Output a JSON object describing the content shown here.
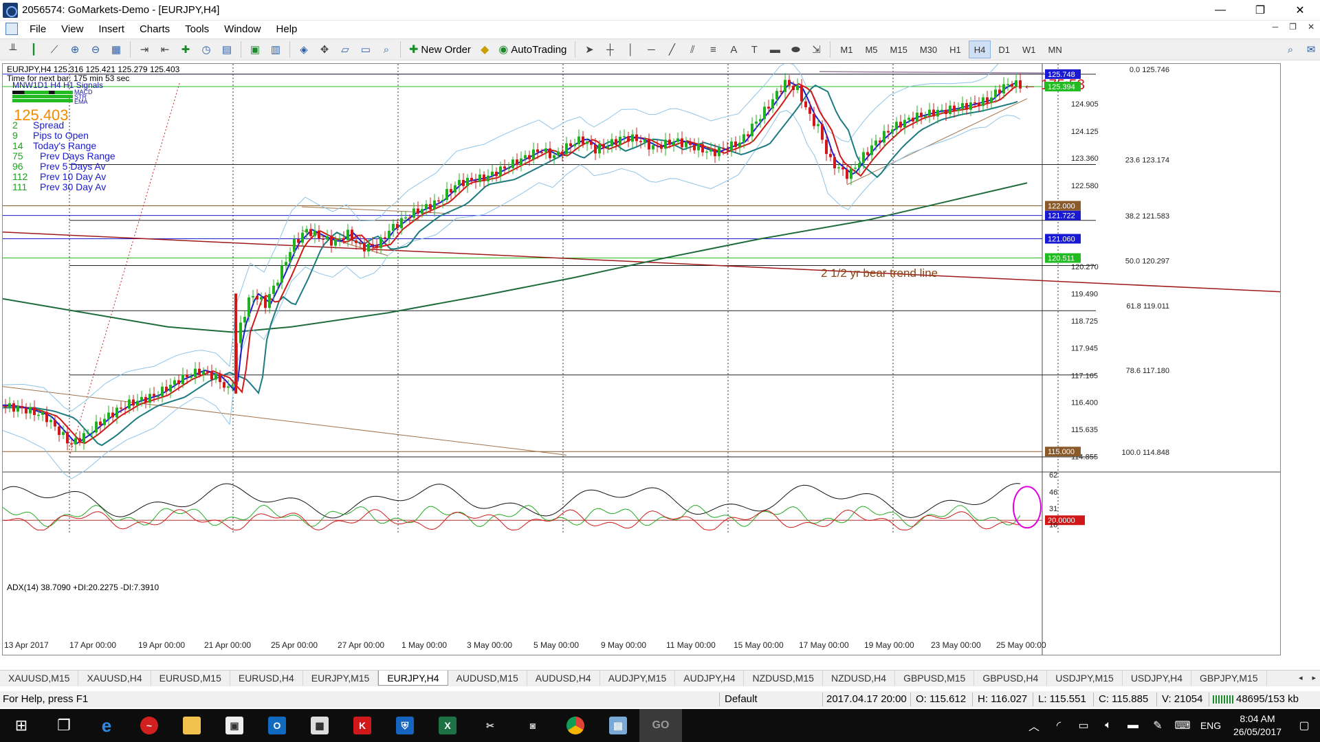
{
  "window": {
    "title": "2056574: GoMarkets-Demo - [EURJPY,H4]",
    "controls": [
      "—",
      "❐",
      "✕"
    ]
  },
  "menu": [
    "File",
    "View",
    "Insert",
    "Charts",
    "Tools",
    "Window",
    "Help"
  ],
  "toolbar": {
    "new_order": "New Order",
    "autotrading": "AutoTrading",
    "timeframes": [
      "M1",
      "M5",
      "M15",
      "M30",
      "H1",
      "H4",
      "D1",
      "W1",
      "MN"
    ],
    "active_timeframe": "H4"
  },
  "chart": {
    "symbol_line": "EURJPY,H4  125.316 125.421 125.279 125.403",
    "time_next_bar": "Time for next bar: 175 min 53 sec",
    "indicator_row": "MNW1D1 H4 H1 Signals",
    "indicator_sub": [
      "MACD",
      "STR",
      "EMA"
    ],
    "big_price": "125.403",
    "stats": [
      {
        "value": "2",
        "label": "Spread"
      },
      {
        "value": "9",
        "label": "Pips to Open"
      },
      {
        "value": "14",
        "label": "Today's Range"
      },
      {
        "value": "75",
        "label": "Prev Days Range"
      },
      {
        "value": "96",
        "label": "Prev 5 Days Av"
      },
      {
        "value": "112",
        "label": "Prev 10 Day Av"
      },
      {
        "value": "111",
        "label": "Prev 30 Day Av"
      }
    ],
    "countdown": "← 175:53",
    "trend_annotation": "2 1/2 yr bear trend line",
    "fib_levels": [
      {
        "label": "0.0 125.746",
        "price": 125.746
      },
      {
        "label": "23.6 123.174",
        "price": 123.174
      },
      {
        "label": "38.2 121.583",
        "price": 121.583
      },
      {
        "label": "50.0 120.297",
        "price": 120.297
      },
      {
        "label": "61.8 119.011",
        "price": 119.011
      },
      {
        "label": "78.6 117.180",
        "price": 117.18
      },
      {
        "label": "100.0 114.848",
        "price": 114.848
      }
    ],
    "price_axis": [
      "124.905",
      "124.125",
      "123.360",
      "122.580",
      "120.270",
      "119.490",
      "118.725",
      "117.945",
      "117.165",
      "116.400",
      "115.635",
      "114.855"
    ],
    "price_axis_values": [
      124.905,
      124.125,
      123.36,
      122.58,
      120.27,
      119.49,
      118.725,
      117.945,
      117.165,
      116.4,
      115.635,
      114.855
    ],
    "highlight_levels": [
      {
        "label": "125.748",
        "price": 125.748,
        "color": "#1a1ad0"
      },
      {
        "label": "125.394",
        "price": 125.394,
        "color": "#22bb22"
      },
      {
        "label": "122.000",
        "price": 122.0,
        "color": "#8b5a2b"
      },
      {
        "label": "121.722",
        "price": 121.722,
        "color": "#1a1ad0"
      },
      {
        "label": "121.060",
        "price": 121.06,
        "color": "#1a1ad0"
      },
      {
        "label": "120.511",
        "price": 120.511,
        "color": "#22bb22"
      },
      {
        "label": "115.000",
        "price": 115.0,
        "color": "#8b5a2b"
      }
    ],
    "time_axis": [
      "13 Apr 2017",
      "17 Apr 00:00",
      "19 Apr 00:00",
      "21 Apr 00:00",
      "25 Apr 00:00",
      "27 Apr 00:00",
      "1 May 00:00",
      "3 May 00:00",
      "5 May 00:00",
      "9 May 00:00",
      "11 May 00:00",
      "15 May 00:00",
      "17 May 00:00",
      "19 May 00:00",
      "23 May 00:00",
      "25 May 00:00"
    ],
    "adx_label": "ADX(14) 38.7090 +DI:20.2275 -DI:7.3910",
    "adx_axis": [
      "62",
      "46",
      "31",
      "16"
    ],
    "adx_level": "20.0000"
  },
  "tabs": [
    "XAUUSD,M15",
    "XAUUSD,H4",
    "EURUSD,M15",
    "EURUSD,H4",
    "EURJPY,M15",
    "EURJPY,H4",
    "AUDUSD,M15",
    "AUDUSD,H4",
    "AUDJPY,M15",
    "AUDJPY,H4",
    "NZDUSD,M15",
    "NZDUSD,H4",
    "GBPUSD,M15",
    "GBPUSD,H4",
    "USDJPY,M15",
    "USDJPY,H4",
    "GBPJPY,M15"
  ],
  "active_tab": "EURJPY,H4",
  "status": {
    "help": "For Help, press F1",
    "profile": "Default",
    "datetime": "2017.04.17 20:00",
    "open": "O: 115.612",
    "high": "H: 116.027",
    "low": "L: 115.551",
    "close": "C: 115.885",
    "volume": "V: 21054",
    "traffic": "48695/153 kb"
  },
  "taskbar": {
    "lang": "ENG",
    "time": "8:04 AM",
    "date": "26/05/2017"
  },
  "colors": {
    "bull_candle": "#22b022",
    "bear_candle": "#d01818",
    "bollinger": "#8ec4e8",
    "ema_fast": "#1a1ad0",
    "ema_mid": "#d01818",
    "ema_slow": "#1a7a80",
    "sma_long": "#1e6b3c",
    "bear_trend": "#a01818"
  }
}
